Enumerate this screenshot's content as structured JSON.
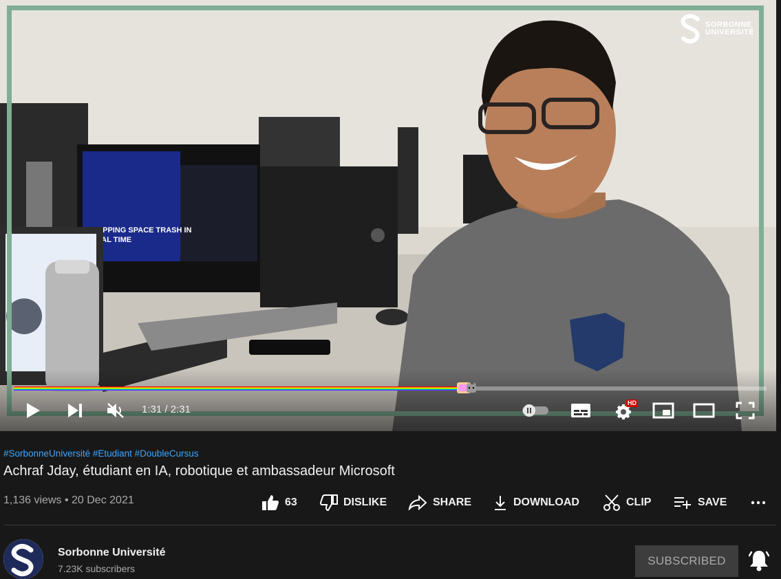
{
  "video": {
    "watermark_text": "SORBONNE\nUNIVERSITÉ",
    "time_current": "1:31",
    "time_separator": " / ",
    "time_total": "2:31",
    "progress_fraction": 0.6,
    "quality_badge": "HD",
    "accent_color": "#7fae94"
  },
  "info": {
    "hashtags": "#SorbonneUniversité #Etudiant #DoubleCursus",
    "title": "Achraf Jday, étudiant en IA, robotique et ambassadeur Microsoft",
    "views": "1,136 views",
    "dot": " • ",
    "date": "20 Dec 2021"
  },
  "actions": {
    "like_count": "63",
    "dislike_label": "DISLIKE",
    "share_label": "SHARE",
    "download_label": "DOWNLOAD",
    "clip_label": "CLIP",
    "save_label": "SAVE"
  },
  "channel": {
    "name": "Sorbonne Université",
    "subscribers": "7.23K subscribers",
    "subscribe_label": "SUBSCRIBED"
  },
  "icons": [
    "play-icon",
    "next-icon",
    "mute-icon",
    "autoplay-toggle-icon",
    "subtitles-icon",
    "settings-icon",
    "miniplayer-icon",
    "theater-icon",
    "fullscreen-icon",
    "like-icon",
    "dislike-icon",
    "share-icon",
    "download-icon",
    "clip-icon",
    "save-icon",
    "more-icon",
    "bell-icon"
  ]
}
